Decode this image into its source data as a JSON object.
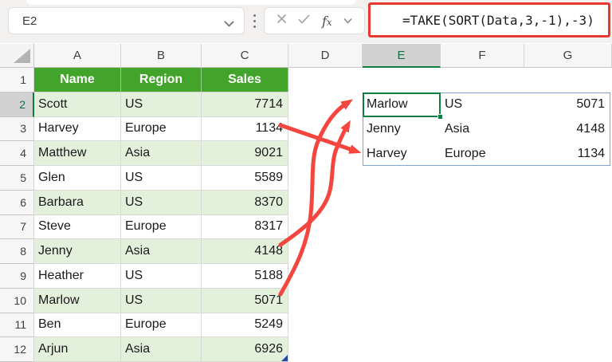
{
  "name_box": {
    "value": "E2"
  },
  "formula_bar": {
    "formula": "=TAKE(SORT(Data,3,-1),-3)",
    "icons": [
      "chevron-down",
      "drag-handle-dots",
      "cancel-x",
      "enter-check",
      "fx-insert-function",
      "chevron-down"
    ]
  },
  "sheet": {
    "column_headers": [
      "A",
      "B",
      "C",
      "D",
      "E",
      "F",
      "G"
    ],
    "row_numbers": [
      "1",
      "2",
      "3",
      "4",
      "5",
      "6",
      "7",
      "8",
      "9",
      "10",
      "11",
      "12"
    ],
    "selected_cell": "E2",
    "selected_column": "E",
    "selected_row": "2",
    "table": {
      "headers": [
        "Name",
        "Region",
        "Sales"
      ],
      "rows": [
        [
          "Scott",
          "US",
          "7714"
        ],
        [
          "Harvey",
          "Europe",
          "1134"
        ],
        [
          "Matthew",
          "Asia",
          "9021"
        ],
        [
          "Glen",
          "US",
          "5589"
        ],
        [
          "Barbara",
          "US",
          "8370"
        ],
        [
          "Steve",
          "Europe",
          "8317"
        ],
        [
          "Jenny",
          "Asia",
          "4148"
        ],
        [
          "Heather",
          "US",
          "5188"
        ],
        [
          "Marlow",
          "US",
          "5071"
        ],
        [
          "Ben",
          "Europe",
          "5249"
        ],
        [
          "Arjun",
          "Asia",
          "6926"
        ]
      ]
    },
    "spill_result": {
      "rows": [
        [
          "Marlow",
          "US",
          "5071"
        ],
        [
          "Jenny",
          "Asia",
          "4148"
        ],
        [
          "Harvey",
          "Europe",
          "1134"
        ]
      ]
    }
  },
  "annotations": {
    "arrows": [
      {
        "from": "sales 5071 row 10",
        "to": "result Marlow E2"
      },
      {
        "from": "sales 4148 row 8",
        "to": "result Jenny E3"
      },
      {
        "from": "sales 1134 row 3",
        "to": "result Harvey E4"
      }
    ]
  },
  "colors": {
    "header_green": "#43a42c",
    "banded_row_green": "#e2f0dc",
    "active_cell_green": "#107c41",
    "spill_border_blue": "#7fa3d7",
    "arrow_red": "#f4453e",
    "formula_border_red": "#e63a30",
    "selected_header_gray": "#d2d2d2"
  }
}
